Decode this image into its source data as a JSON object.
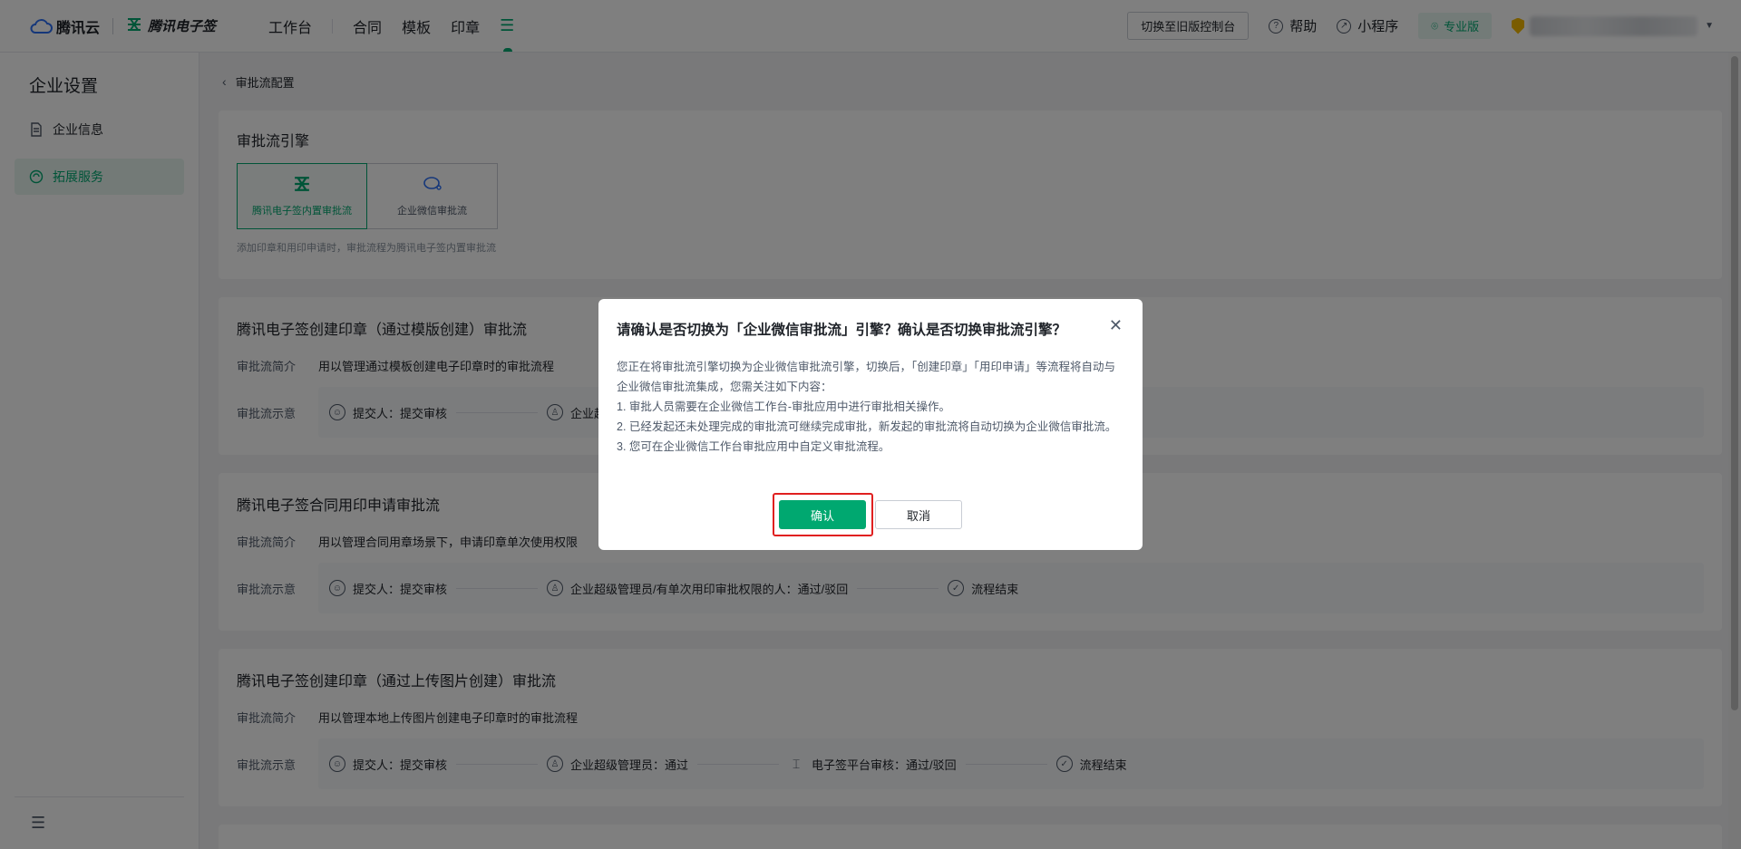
{
  "topbar": {
    "brand": "腾讯云",
    "product": "腾讯电子签",
    "nav": [
      "工作台",
      "合同",
      "模板",
      "印章"
    ],
    "switch_old": "切换至旧版控制台",
    "help": "帮助",
    "mini_program": "小程序",
    "edition": "专业版"
  },
  "sidebar": {
    "title": "企业设置",
    "items": [
      {
        "label": "企业信息",
        "icon": "document-icon"
      },
      {
        "label": "拓展服务",
        "icon": "extension-icon",
        "active": true
      }
    ]
  },
  "main": {
    "breadcrumb": "审批流配置",
    "engine": {
      "title": "审批流引擎",
      "options": [
        "腾讯电子签内置审批流",
        "企业微信审批流"
      ],
      "hint": "添加印章和用印申请时，审批流程为腾讯电子签内置审批流"
    },
    "flows": [
      {
        "title": "腾讯电子签创建印章（通过模版创建）审批流",
        "intro_label": "审批流简介",
        "intro": "用以管理通过模板创建电子印章时的审批流程",
        "diagram_label": "审批流示意",
        "steps": [
          "提交人：提交审核",
          "企业超"
        ]
      },
      {
        "title": "腾讯电子签合同用印申请审批流",
        "intro_label": "审批流简介",
        "intro": "用以管理合同用章场景下，申请印章单次使用权限",
        "diagram_label": "审批流示意",
        "steps": [
          "提交人：提交审核",
          "企业超级管理员/有单次用印审批权限的人：通过/驳回",
          "流程结束"
        ]
      },
      {
        "title": "腾讯电子签创建印章（通过上传图片创建）审批流",
        "intro_label": "审批流简介",
        "intro": "用以管理本地上传图片创建电子印章时的审批流程",
        "diagram_label": "审批流示意",
        "steps": [
          "提交人：提交审核",
          "企业超级管理员：通过",
          "电子签平台审核：通过/驳回",
          "流程结束"
        ]
      }
    ]
  },
  "modal": {
    "title": "请确认是否切换为「企业微信审批流」引擎？确认是否切换审批流引擎？",
    "body_intro": "您正在将审批流引擎切换为企业微信审批流引擎，切换后，「创建印章」「用印申请」等流程将自动与企业微信审批流集成，您需关注如下内容：",
    "points": [
      "1. 审批人员需要在企业微信工作台-审批应用中进行审批相关操作。",
      "2. 已经发起还未处理完成的审批流可继续完成审批，新发起的审批流将自动切换为企业微信审批流。",
      "3. 您可在企业微信工作台审批应用中自定义审批流程。"
    ],
    "confirm": "确认",
    "cancel": "取消"
  },
  "colors": {
    "accent": "#00a870",
    "highlight": "#e02020"
  }
}
